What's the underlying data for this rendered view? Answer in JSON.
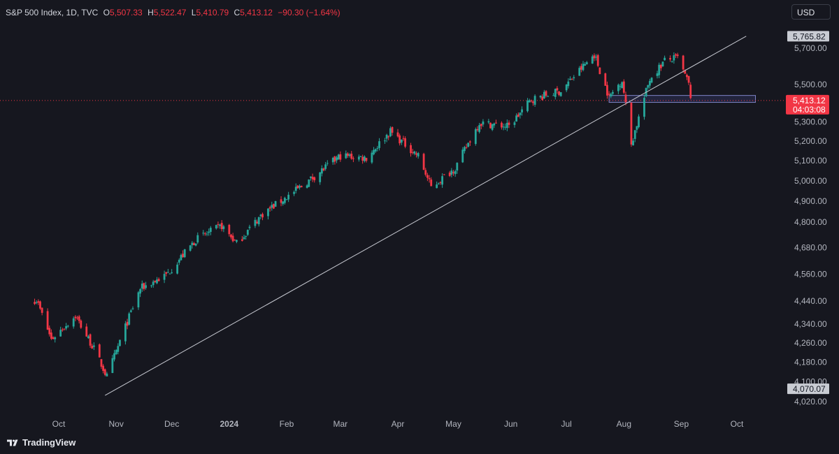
{
  "legend": {
    "symbol": "S&P 500 Index, 1D, TVC",
    "o_label": "O",
    "o_value": "5,507.33",
    "h_label": "H",
    "h_value": "5,522.47",
    "l_label": "L",
    "l_value": "5,410.79",
    "c_label": "C",
    "c_value": "5,413.12",
    "change": "−90.30 (−1.64%)"
  },
  "currency": "USD",
  "brand": {
    "name": "TradingView"
  },
  "colors": {
    "background": "#16171f",
    "up": "#26a69a",
    "down": "#f23645",
    "trendline": "#c8cad2",
    "zone": "#7e84c8",
    "price_line": "#f23645"
  },
  "chart_data": {
    "type": "candlestick",
    "symbol": "S&P 500 Index",
    "interval": "1D",
    "x_ticks": [
      {
        "label": "Oct",
        "date": "2023-10-01"
      },
      {
        "label": "Nov",
        "date": "2023-11-01"
      },
      {
        "label": "Dec",
        "date": "2023-12-01"
      },
      {
        "label": "2024",
        "date": "2024-01-01",
        "bold": true
      },
      {
        "label": "Feb",
        "date": "2024-02-01"
      },
      {
        "label": "Mar",
        "date": "2024-03-01"
      },
      {
        "label": "Apr",
        "date": "2024-04-01"
      },
      {
        "label": "May",
        "date": "2024-05-01"
      },
      {
        "label": "Jun",
        "date": "2024-06-01"
      },
      {
        "label": "Jul",
        "date": "2024-07-01"
      },
      {
        "label": "Aug",
        "date": "2024-08-01"
      },
      {
        "label": "Sep",
        "date": "2024-09-01"
      },
      {
        "label": "Oct",
        "date": "2024-10-01"
      }
    ],
    "y_ticks": [
      {
        "label": "5,700.00",
        "value": 5700
      },
      {
        "label": "5,500.00",
        "value": 5500
      },
      {
        "label": "5,300.00",
        "value": 5300
      },
      {
        "label": "5,200.00",
        "value": 5200
      },
      {
        "label": "5,100.00",
        "value": 5100
      },
      {
        "label": "5,000.00",
        "value": 5000
      },
      {
        "label": "4,900.00",
        "value": 4900
      },
      {
        "label": "4,800.00",
        "value": 4800
      },
      {
        "label": "4,680.00",
        "value": 4680
      },
      {
        "label": "4,560.00",
        "value": 4560
      },
      {
        "label": "4,440.00",
        "value": 4440
      },
      {
        "label": "4,340.00",
        "value": 4340
      },
      {
        "label": "4,260.00",
        "value": 4260
      },
      {
        "label": "4,180.00",
        "value": 4180
      },
      {
        "label": "4,100.00",
        "value": 4100
      },
      {
        "label": "4,020.00",
        "value": 4020
      }
    ],
    "log_scale": true,
    "grid": false,
    "price_labels": [
      {
        "text": "5,765.82",
        "value": 5765.82,
        "style": "light"
      },
      {
        "text": "4,070.07",
        "value": 4070.07,
        "style": "light"
      },
      {
        "text": "5,413.12",
        "sub": "04:03:08",
        "value": 5413.12,
        "style": "last"
      }
    ],
    "last_price": 5413.12,
    "trendline": {
      "start": {
        "date": "2023-10-26",
        "value": 4045
      },
      "end": {
        "date": "2024-10-06",
        "value": 5768
      }
    },
    "zone": {
      "start_date": "2024-07-24",
      "end_date": "2024-10-11",
      "top": 5440,
      "bottom": 5403
    },
    "anchors": [
      {
        "date": "2023-09-19",
        "value": 4445
      },
      {
        "date": "2023-09-27",
        "value": 4275
      },
      {
        "date": "2023-10-10",
        "value": 4375
      },
      {
        "date": "2023-10-20",
        "value": 4235
      },
      {
        "date": "2023-10-27",
        "value": 4120
      },
      {
        "date": "2023-11-14",
        "value": 4495
      },
      {
        "date": "2023-11-28",
        "value": 4555
      },
      {
        "date": "2023-12-14",
        "value": 4718
      },
      {
        "date": "2023-12-28",
        "value": 4782
      },
      {
        "date": "2024-01-05",
        "value": 4700
      },
      {
        "date": "2024-01-19",
        "value": 4840
      },
      {
        "date": "2024-02-05",
        "value": 4945
      },
      {
        "date": "2024-02-15",
        "value": 5015
      },
      {
        "date": "2024-03-01",
        "value": 5125
      },
      {
        "date": "2024-03-15",
        "value": 5115
      },
      {
        "date": "2024-03-28",
        "value": 5250
      },
      {
        "date": "2024-04-12",
        "value": 5125
      },
      {
        "date": "2024-04-19",
        "value": 4968
      },
      {
        "date": "2024-05-02",
        "value": 5065
      },
      {
        "date": "2024-05-15",
        "value": 5295
      },
      {
        "date": "2024-05-31",
        "value": 5275
      },
      {
        "date": "2024-06-12",
        "value": 5418
      },
      {
        "date": "2024-06-28",
        "value": 5465
      },
      {
        "date": "2024-07-16",
        "value": 5665
      },
      {
        "date": "2024-07-24",
        "value": 5430
      },
      {
        "date": "2024-07-31",
        "value": 5525
      },
      {
        "date": "2024-08-05",
        "value": 5185
      },
      {
        "date": "2024-08-15",
        "value": 5530
      },
      {
        "date": "2024-08-23",
        "value": 5630
      },
      {
        "date": "2024-08-30",
        "value": 5645
      },
      {
        "date": "2024-09-05",
        "value": 5500
      },
      {
        "date": "2024-09-06",
        "value": 5413
      }
    ]
  }
}
